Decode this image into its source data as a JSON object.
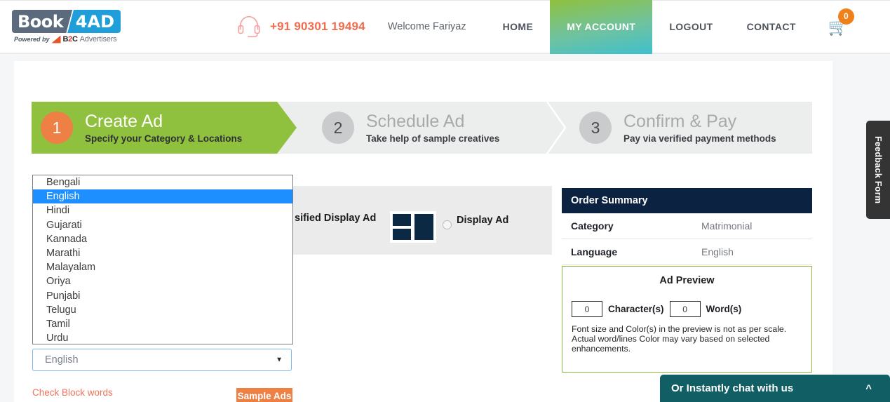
{
  "header": {
    "logo": {
      "book": "Book",
      "fourad": "4AD",
      "powered_by": "Powered by",
      "b2c_prefix": "B",
      "b2c_two": "2",
      "b2c_suffix": "C",
      "advertisers": "Advertisers"
    },
    "phone": "+91 90301 19494",
    "welcome": "Welcome Fariyaz",
    "nav": [
      {
        "label": "HOME",
        "active": false
      },
      {
        "label": "MY ACCOUNT",
        "active": true
      },
      {
        "label": "LOGOUT",
        "active": false
      },
      {
        "label": "CONTACT",
        "active": false
      }
    ],
    "cart_count": "0",
    "accent_active": "#8fc13f",
    "accent_phone": "#f26c4f"
  },
  "wizard": {
    "steps": [
      {
        "number": "1",
        "title": "Create Ad",
        "subtitle": "Specify your Category & Locations",
        "active": true
      },
      {
        "number": "2",
        "title": "Schedule Ad",
        "subtitle": "Take help of sample creatives",
        "active": false
      },
      {
        "number": "3",
        "title": "Confirm & Pay",
        "subtitle": "Pay via verified payment methods",
        "active": false
      }
    ]
  },
  "ad_type": {
    "classified_display_label": "sified Display Ad",
    "display_label": "Display Ad",
    "display_selected": false
  },
  "language_dropdown": {
    "selected": "English",
    "open": true,
    "options": [
      "Bengali",
      "English",
      "Hindi",
      "Gujarati",
      "Kannada",
      "Marathi",
      "Malayalam",
      "Oriya",
      "Punjabi",
      "Telugu",
      "Tamil",
      "Urdu"
    ],
    "caret": "▼"
  },
  "actions": {
    "block_words": "Check Block words",
    "sample_ads": "Sample Ads"
  },
  "order_summary": {
    "title": "Order Summary",
    "rows": [
      {
        "key": "Category",
        "value": "Matrimonial"
      },
      {
        "key": "Language",
        "value": "English"
      }
    ]
  },
  "ad_preview": {
    "title": "Ad Preview",
    "character_count": "0",
    "character_label": "Character(s)",
    "word_count": "0",
    "word_label": "Word(s)",
    "note": "Font size and Color(s) in the preview is not as per scale. Actual word/lines Color may vary based on selected enhancements."
  },
  "feedback": {
    "label": "Feedback Form"
  },
  "chat": {
    "label": "Or Instantly chat with us",
    "caret": "⌃"
  }
}
